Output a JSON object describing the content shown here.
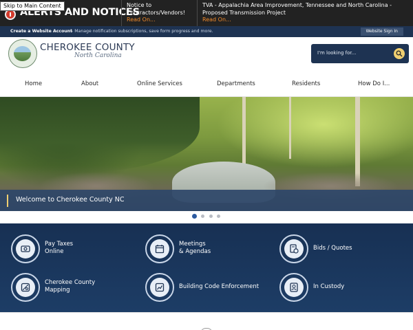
{
  "skip_link": "Skip to Main Content",
  "alerts": {
    "title": "ALERTS AND NOTICES",
    "items": [
      {
        "text": "Notice to Contractors/Vendors!",
        "read_on": "Read On..."
      },
      {
        "text": "TVA - Appalachia Area Improvement, Tennessee and North Carolina - Proposed Transmission Project",
        "read_on": "Read On..."
      }
    ]
  },
  "utility": {
    "create": "Create a Website Account",
    "desc": "- Manage notification subscriptions, save form progress and more.",
    "sign_in": "Website Sign In"
  },
  "header": {
    "site_name": "CHEROKEE COUNTY",
    "site_sub": "North Carolina",
    "search_placeholder": "I'm looking for..."
  },
  "nav": {
    "items": [
      "Home",
      "About",
      "Online Services",
      "Departments",
      "Residents",
      "How Do I..."
    ]
  },
  "hero": {
    "caption": "Welcome to Cherokee County NC",
    "slides": 4,
    "active_slide": 1
  },
  "quick_links": [
    {
      "line1": "Pay Taxes",
      "line2": "Online",
      "icon": "money-icon"
    },
    {
      "line1": "Meetings",
      "line2": "& Agendas",
      "icon": "calendar-icon"
    },
    {
      "line1": "Bids / Quotes",
      "line2": "",
      "icon": "document-clock-icon"
    },
    {
      "line1": "Cherokee County",
      "line2": "Mapping",
      "icon": "map-icon"
    },
    {
      "line1": "Building Code Enforcement",
      "line2": "",
      "icon": "building-chart-icon"
    },
    {
      "line1": "In Custody",
      "line2": "",
      "icon": "person-badge-icon"
    }
  ],
  "colors": {
    "navy": "#1e3352",
    "accent": "#f0cf70",
    "alert_red": "#d43b2c",
    "read_on": "#f08a2c"
  }
}
